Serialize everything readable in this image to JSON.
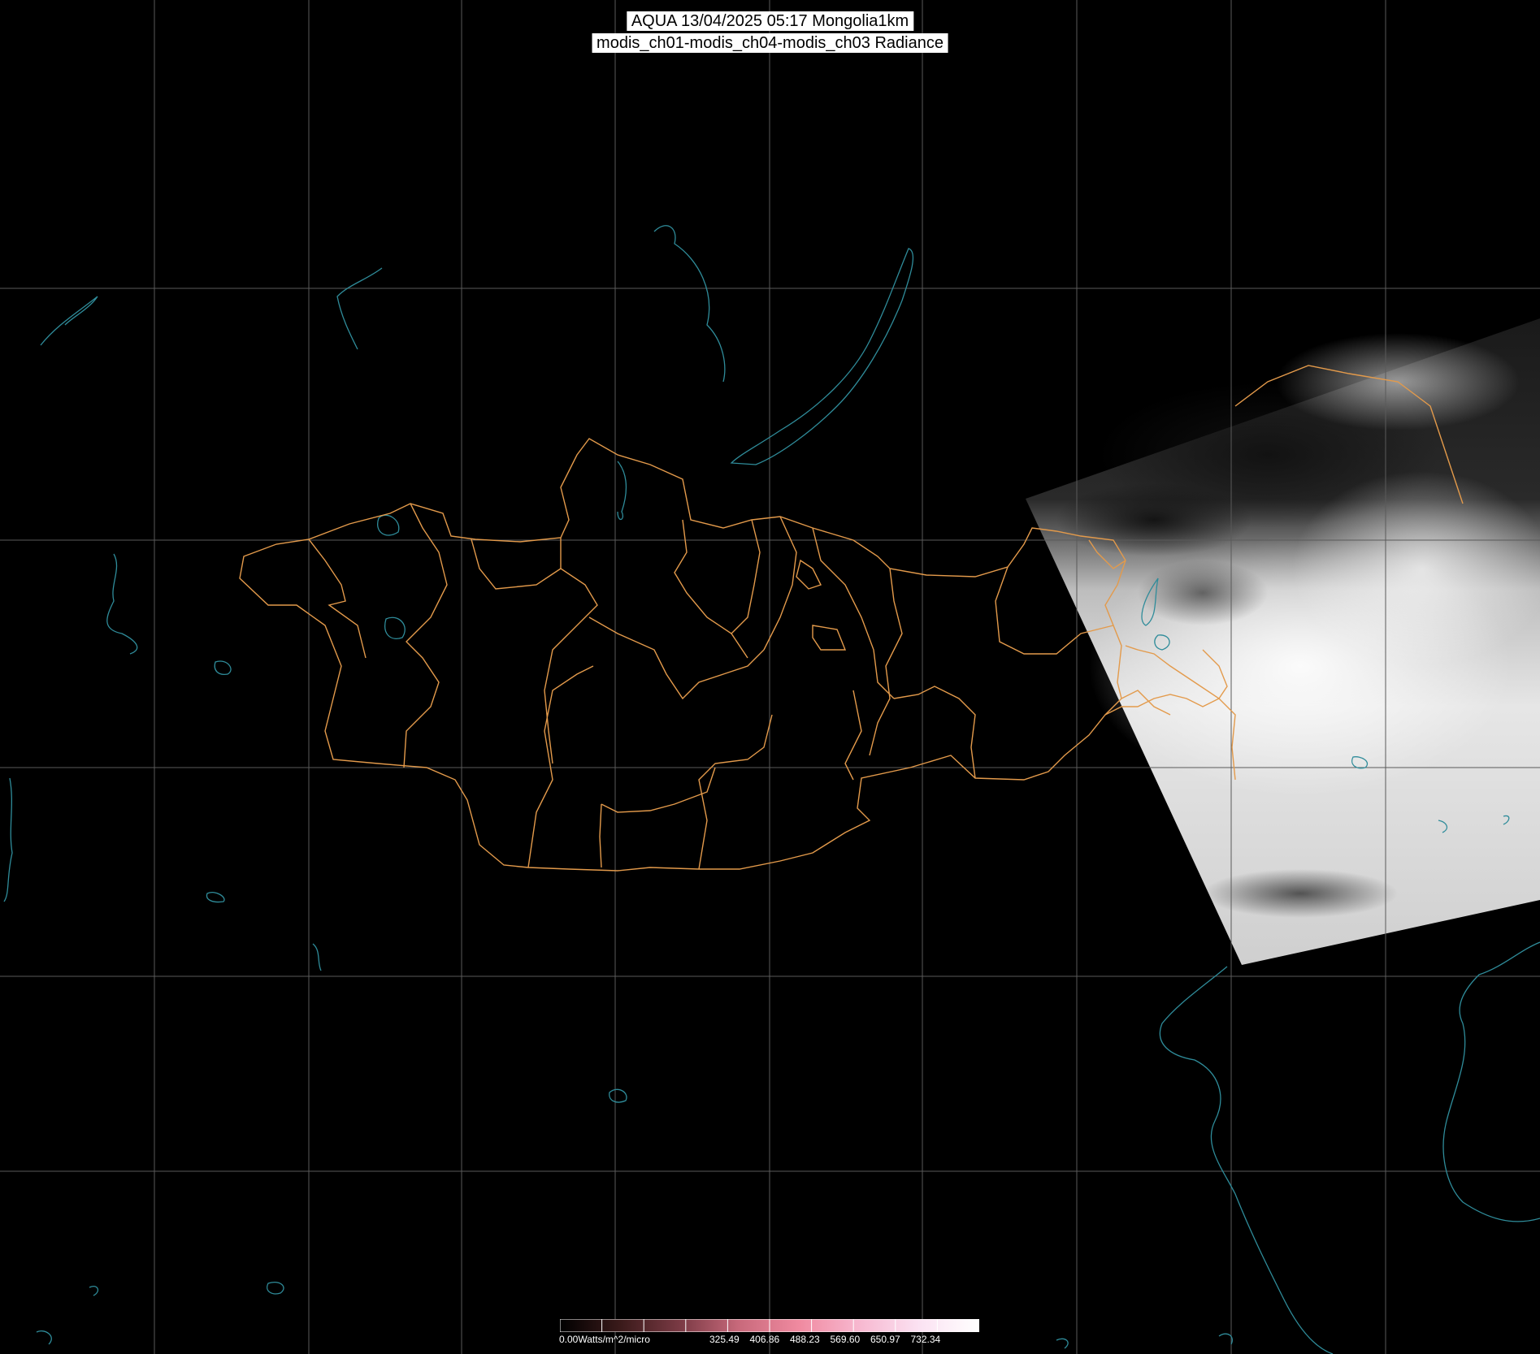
{
  "header": {
    "title_line1": "AQUA 13/04/2025 05:17 Mongolia1km",
    "title_line2": "modis_ch01-modis_ch04-modis_ch03 Radiance"
  },
  "legend": {
    "min_label": "0.00Watts/m^2/micro",
    "tick_labels": [
      "325.49",
      "406.86",
      "488.23",
      "569.60",
      "650.97",
      "732.34"
    ],
    "gradient_colors": [
      "#000000",
      "#3a1a1a",
      "#7a3a44",
      "#c96a7c",
      "#f08aa0",
      "#f7b8d0",
      "#fbe2f2",
      "#ffffff"
    ]
  },
  "colors": {
    "background": "#000000",
    "grid": "#5a5a5a",
    "admin_border": "#e39a4b",
    "coastline": "#2f8c9a",
    "imagery_swath": "#d8d8d8"
  },
  "layers": {
    "grid_label": "lat-lon-grid",
    "borders_label": "mongolia-aimag-borders",
    "water_label": "lakes-rivers-coastline",
    "swath_label": "modis-swath"
  }
}
